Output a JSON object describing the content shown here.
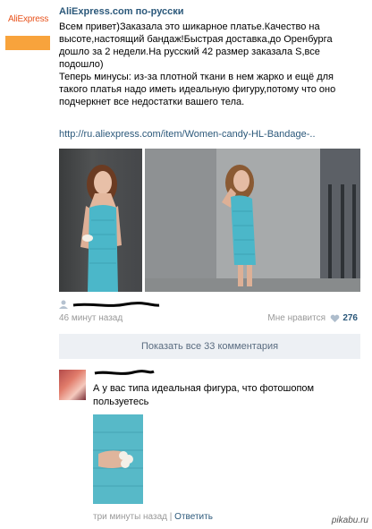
{
  "group": {
    "logo_text": "AliExpress",
    "name": "AliExpress.com по-русски"
  },
  "post": {
    "text_lines": [
      "Всем привет)Заказала это шикарное платье.Качество на высоте,настоящий бандаж!Быстрая доставка,до Оренбурга дошло за 2 недели.На русский 42 размер заказала S,все подошло)",
      "Теперь минусы: из-за плотной ткани в нем жарко и ещё для такого платья надо иметь идеальную фигуру,потому что оно подчеркнет все недостатки вашего тела."
    ],
    "link": "http://ru.aliexpress.com/item/Women-candy-HL-Bandage-..",
    "time": "46 минут назад",
    "like_label": "Мне нравится",
    "like_count": "276"
  },
  "show_all_comments": "Показать все 33 комментария",
  "comment": {
    "text": "А у вас типа идеальная фигура, что фотошопом пользуетесь",
    "time": "три минуты назад",
    "separator": "|",
    "reply": "Ответить"
  },
  "watermark": "pikabu.ru",
  "icons": [
    "user-icon",
    "heart-icon"
  ],
  "colors": {
    "link": "#2b587a",
    "meta": "#999999",
    "button_bg": "#edf0f4",
    "dress": "#4bb7c9",
    "logo_orange": "#f8a33c"
  }
}
